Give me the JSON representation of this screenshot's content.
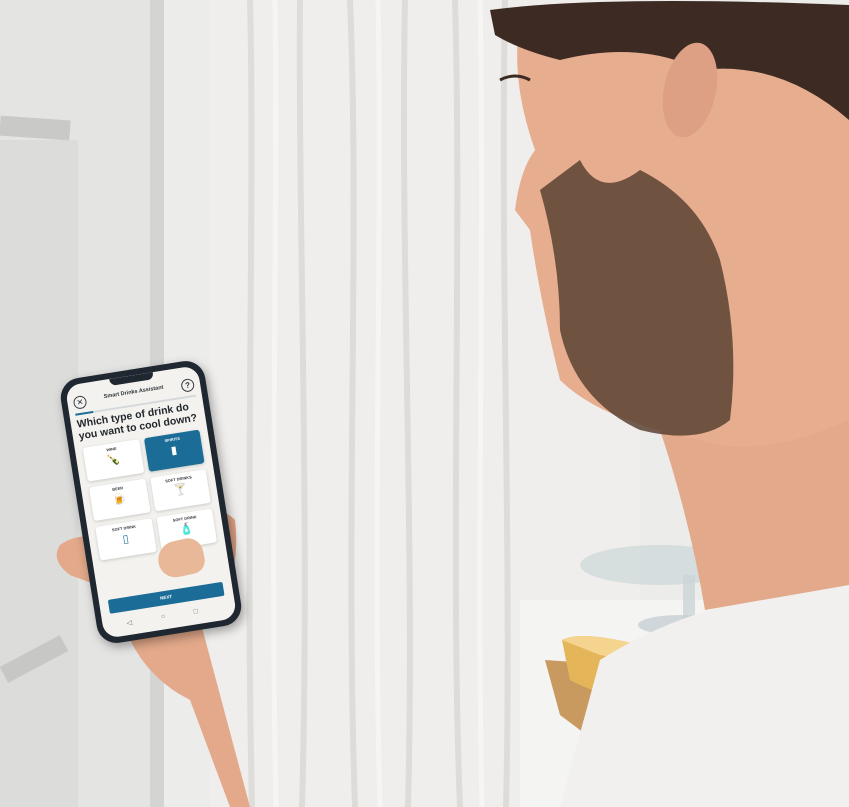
{
  "app": {
    "title": "Smart Drinks Assistant",
    "close_icon": "close-icon",
    "help_icon": "help-icon",
    "progress": 0.15,
    "question": "Which type of drink do you want to cool down?",
    "options": [
      {
        "label": "WINE",
        "icon": "wine-bottle-icon",
        "selected": false
      },
      {
        "label": "SPIRITS",
        "icon": "spirits-bottle-icon",
        "selected": true
      },
      {
        "label": "BEER",
        "icon": "beer-mug-icon",
        "selected": false
      },
      {
        "label": "SOFT DRINKS",
        "icon": "cocktail-icon",
        "selected": false
      },
      {
        "label": "SOFT DRINK",
        "icon": "glass-icon",
        "selected": false
      },
      {
        "label": "SOFT DRINK",
        "icon": "bottle-icon",
        "selected": false
      }
    ],
    "next_label": "NEXT",
    "nav": {
      "back": "◁",
      "home": "○",
      "recent": "□"
    }
  },
  "colors": {
    "accent": "#1b6d98",
    "screen_bg": "#f3f2ef",
    "phone_frame": "#1f2730"
  }
}
